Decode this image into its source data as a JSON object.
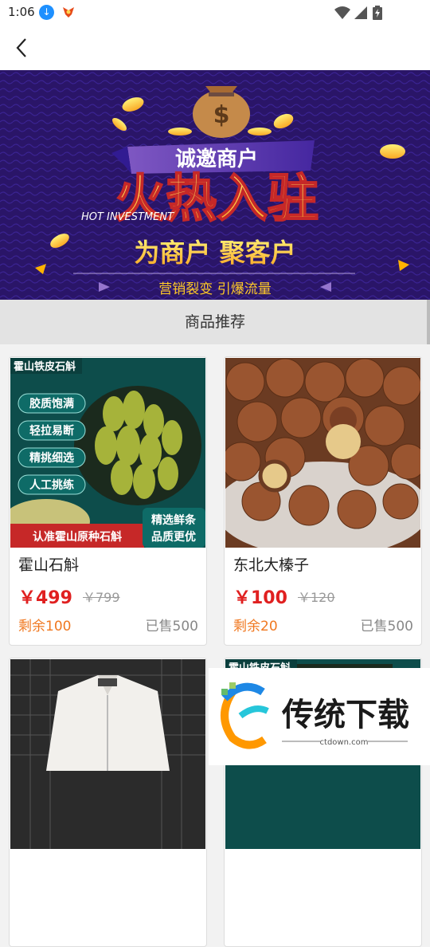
{
  "status": {
    "time": "1:06"
  },
  "banner": {
    "headline_small": "诚邀商户",
    "headline_big": "火热入驻",
    "sub_en": "HOT INVESTMENT",
    "line2": "为商户  聚客户",
    "line3": "营销裂变  引爆流量",
    "bag_symbol": "$"
  },
  "section": {
    "title": "商品推荐"
  },
  "products": [
    {
      "name": "霍山石斛",
      "price": "￥499",
      "old_price": "￥799",
      "stock": "剩余100",
      "sold": "已售500",
      "img_title": "霍山铁皮石斛",
      "tags": [
        "胶质饱满",
        "轻拉易断",
        "精挑细选",
        "人工挑练"
      ],
      "bottom_left": "认准霍山原种石斛",
      "bottom_right_1": "精选鲜条",
      "bottom_right_2": "品质更优"
    },
    {
      "name": "东北大榛子",
      "price": "￥100",
      "old_price": "￥120",
      "stock": "剩余20",
      "sold": "已售500"
    }
  ],
  "partial": {
    "img_title": "霍山铁皮石斛"
  },
  "watermark": {
    "brand": "传统下载",
    "url": "ctdown.com"
  }
}
